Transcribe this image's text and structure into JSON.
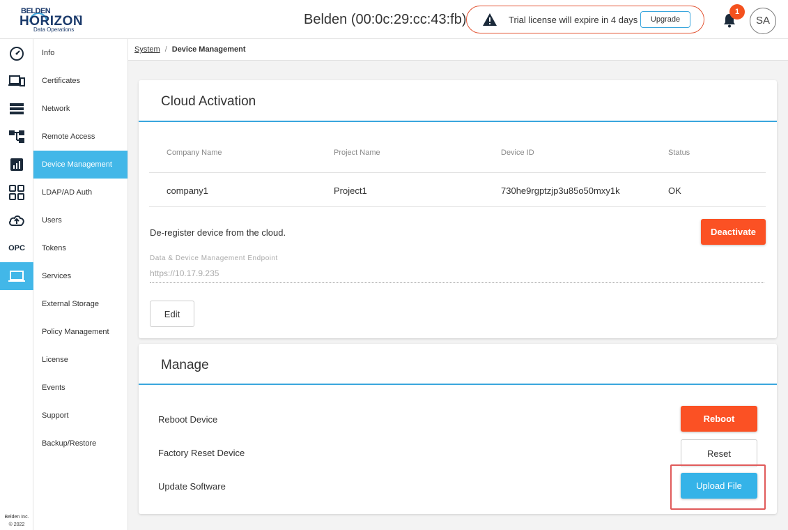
{
  "header": {
    "logo": {
      "brand": "BELDEN",
      "product": "HORIZON",
      "tm": "™",
      "subtitle": "Data Operations"
    },
    "device_title": "Belden (00:0c:29:cc:43:fb)",
    "trial_notice": "Trial license will expire in 4 days",
    "upgrade_label": "Upgrade",
    "notification_count": "1",
    "avatar_initials": "SA",
    "alert_color": "#f4511e"
  },
  "rail": {
    "items": [
      {
        "icon": "dashboard-gauge-icon"
      },
      {
        "icon": "devices-icon"
      },
      {
        "icon": "list-icon"
      },
      {
        "icon": "hierarchy-icon"
      },
      {
        "icon": "analytics-icon"
      },
      {
        "icon": "apps-grid-icon"
      },
      {
        "icon": "cloud-upload-icon"
      },
      {
        "icon": "opc-icon",
        "text": "OPC"
      },
      {
        "icon": "laptop-icon",
        "active": true
      }
    ],
    "footer_company": "Belden Inc.",
    "footer_year": "© 2022"
  },
  "submenu": {
    "items": [
      {
        "label": "Info"
      },
      {
        "label": "Certificates"
      },
      {
        "label": "Network"
      },
      {
        "label": "Remote Access"
      },
      {
        "label": "Device Management",
        "active": true
      },
      {
        "label": "LDAP/AD Auth"
      },
      {
        "label": "Users"
      },
      {
        "label": "Tokens"
      },
      {
        "label": "Services"
      },
      {
        "label": "External Storage"
      },
      {
        "label": "Policy Management"
      },
      {
        "label": "License"
      },
      {
        "label": "Events"
      },
      {
        "label": "Support"
      },
      {
        "label": "Backup/Restore"
      }
    ],
    "active_color": "#42b7e8"
  },
  "breadcrumb": {
    "parent": "System",
    "separator": "/",
    "current": "Device Management"
  },
  "cloud": {
    "title": "Cloud Activation",
    "headers": [
      "Company Name",
      "Project Name",
      "Device ID",
      "Status"
    ],
    "row": [
      "company1",
      "Project1",
      "730he9rgptzjp3u85o50mxy1k",
      "OK"
    ],
    "deregister_text": "De-register device from the cloud.",
    "deactivate_label": "Deactivate",
    "endpoint_label": "Data & Device Management Endpoint",
    "endpoint_value": "https://10.17.9.235",
    "edit_label": "Edit"
  },
  "manage": {
    "title": "Manage",
    "reboot_text": "Reboot Device",
    "reboot_label": "Reboot",
    "reset_text": "Factory Reset Device",
    "reset_label": "Reset",
    "update_text": "Update Software",
    "upload_label": "Upload File",
    "primary_color": "#fb5124",
    "upload_color": "#35b3e8"
  }
}
